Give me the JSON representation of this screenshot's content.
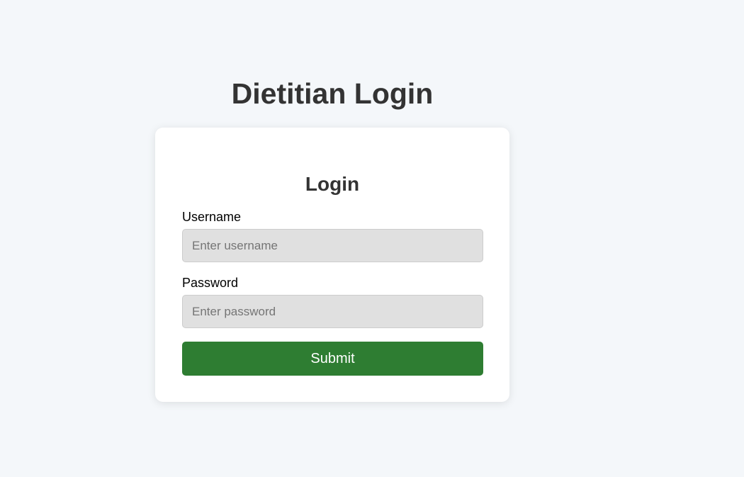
{
  "page": {
    "title": "Dietitian Login"
  },
  "login_card": {
    "title": "Login",
    "username": {
      "label": "Username",
      "value": "",
      "placeholder": "Enter username"
    },
    "password": {
      "label": "Password",
      "value": "",
      "placeholder": "Enter password"
    },
    "submit_label": "Submit"
  },
  "colors": {
    "background": "#f4f7fa",
    "card": "#ffffff",
    "input_fill": "#e0e0e0",
    "submit_button": "#2e7d32",
    "heading_text": "#333333"
  }
}
